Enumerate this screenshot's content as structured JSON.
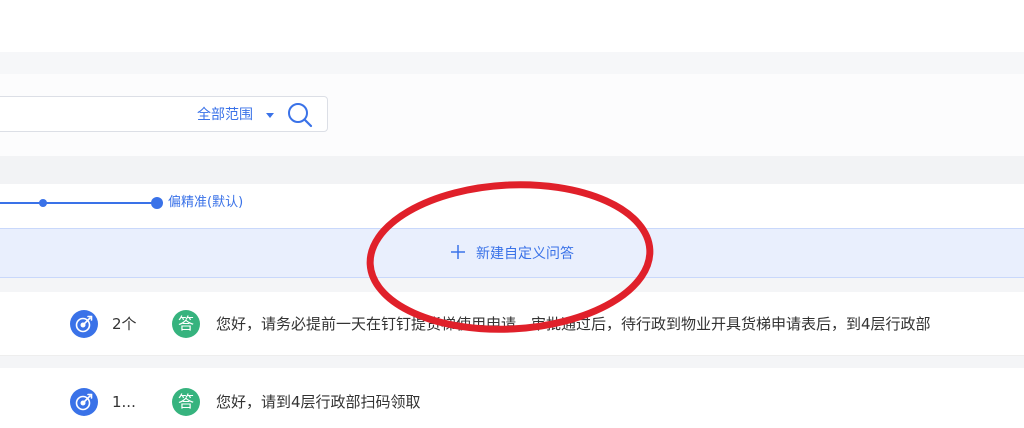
{
  "search": {
    "scope_label": "全部范围",
    "icons": {
      "caret": "caret-down-icon",
      "search": "search-icon"
    }
  },
  "slider": {
    "label": "偏精准(默认)"
  },
  "new_qa": {
    "label": "新建自定义问答",
    "icon": "plus-icon"
  },
  "rows": [
    {
      "count": "2个",
      "badge": "答",
      "answer": "您好，请务必提前一天在钉钉提货梯使用申请，审批通过后，待行政到物业开具货梯申请表后，到4层行政部"
    },
    {
      "count": "1...",
      "badge": "答",
      "answer": "您好，请到4层行政部扫码领取"
    }
  ],
  "colors": {
    "accent": "#3a72e8",
    "answer_badge": "#36b37e",
    "annotation_ring": "#e0202a",
    "new_bar_bg": "#e9effd"
  }
}
